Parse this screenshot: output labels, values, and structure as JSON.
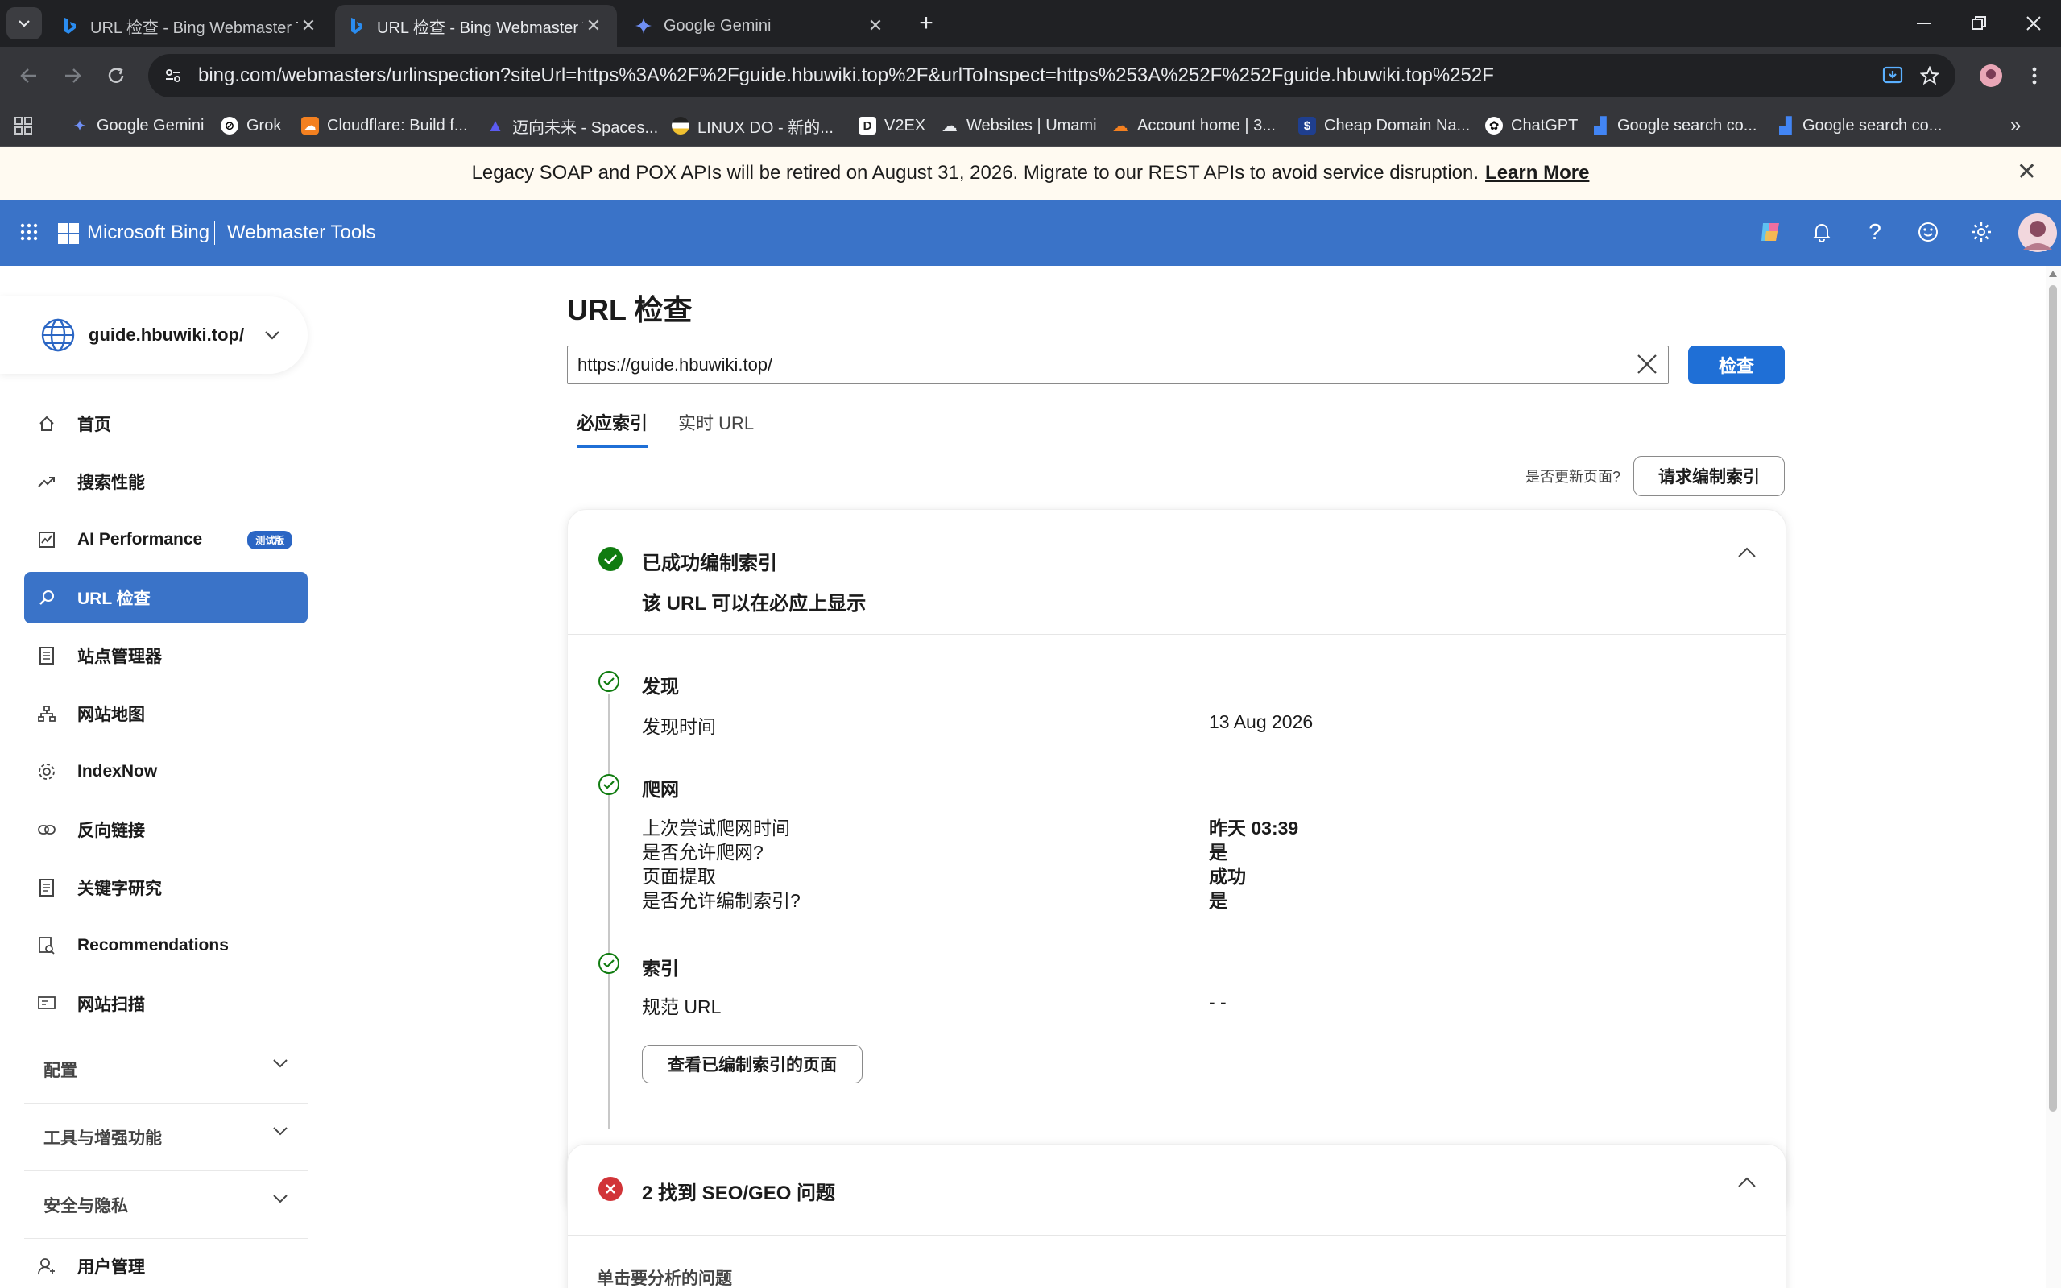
{
  "browser": {
    "tabs": [
      {
        "title": "URL 检查 - Bing Webmaster T",
        "active": false
      },
      {
        "title": "URL 检查 - Bing Webmaster T",
        "active": true
      },
      {
        "title": "Google Gemini",
        "active": false
      }
    ],
    "address": "bing.com/webmasters/urlinspection?siteUrl=https%3A%2F%2Fguide.hbuwiki.top%2F&urlToInspect=https%253A%252F%252Fguide.hbuwiki.top%252F",
    "bookmarks": [
      {
        "label": "Google Gemini",
        "color": "#4a8af4"
      },
      {
        "label": "Grok",
        "color": "#111111"
      },
      {
        "label": "Cloudflare: Build f...",
        "color": "#f38020"
      },
      {
        "label": "迈向未来 - Spaces...",
        "color": "#5b5bf0"
      },
      {
        "label": "LINUX DO - 新的...",
        "color": "#f0c030"
      },
      {
        "label": "V2EX",
        "color": "#222222"
      },
      {
        "label": "Websites | Umami",
        "color": "#444444"
      },
      {
        "label": "Account home | 3...",
        "color": "#f38020"
      },
      {
        "label": "Cheap Domain Na...",
        "color": "#1f3f8f"
      },
      {
        "label": "ChatGPT",
        "color": "#444444"
      },
      {
        "label": "Google search co...",
        "color": "#4285f4"
      },
      {
        "label": "Google search co...",
        "color": "#4285f4"
      }
    ]
  },
  "banner": {
    "text": "Legacy SOAP and POX APIs will be retired on August 31, 2026. Migrate to our REST APIs to avoid service disruption.",
    "link": "Learn More"
  },
  "header": {
    "brand": "Microsoft Bing",
    "product": "Webmaster Tools"
  },
  "sidebar": {
    "site": "guide.hbuwiki.top/",
    "items": [
      {
        "label": "首页"
      },
      {
        "label": "搜索性能"
      },
      {
        "label": "AI Performance",
        "badge": "测试版"
      },
      {
        "label": "URL 检查",
        "active": true
      },
      {
        "label": "站点管理器"
      },
      {
        "label": "网站地图"
      },
      {
        "label": "IndexNow"
      },
      {
        "label": "反向链接"
      },
      {
        "label": "关键字研究"
      },
      {
        "label": "Recommendations"
      },
      {
        "label": "网站扫描"
      }
    ],
    "sections": [
      {
        "label": "配置"
      },
      {
        "label": "工具与增强功能"
      },
      {
        "label": "安全与隐私"
      }
    ],
    "bottom_item": "用户管理"
  },
  "main": {
    "title": "URL 检查",
    "url_value": "https://guide.hbuwiki.top/",
    "inspect_label": "检查",
    "tabs": [
      {
        "label": "必应索引",
        "active": true
      },
      {
        "label": "实时 URL",
        "active": false
      }
    ],
    "update_question": "是否更新页面?",
    "reindex_label": "请求编制索引",
    "status_card": {
      "title": "已成功编制索引",
      "subtitle": "该 URL 可以在必应上显示",
      "discovery": {
        "title": "发现",
        "rows": [
          {
            "key": "发现时间",
            "value": "13 Aug 2026"
          }
        ]
      },
      "crawl": {
        "title": "爬网",
        "rows": [
          {
            "key": "上次尝试爬网时间",
            "value": "昨天 03:39"
          },
          {
            "key": "是否允许爬网?",
            "value": "是"
          },
          {
            "key": "页面提取",
            "value": "成功"
          },
          {
            "key": "是否允许编制索引?",
            "value": "是"
          }
        ]
      },
      "index": {
        "title": "索引",
        "rows": [
          {
            "key": "规范 URL",
            "value": "- -"
          }
        ]
      },
      "view_button": "查看已编制索引的页面"
    },
    "issues_card": {
      "title": "2 找到 SEO/GEO 问题",
      "hint": "单击要分析的问题"
    }
  },
  "colors": {
    "header_blue": "#3a73c8",
    "success_green": "#107c10",
    "error_red": "#d13438",
    "primary_button": "#1f6fd6"
  }
}
